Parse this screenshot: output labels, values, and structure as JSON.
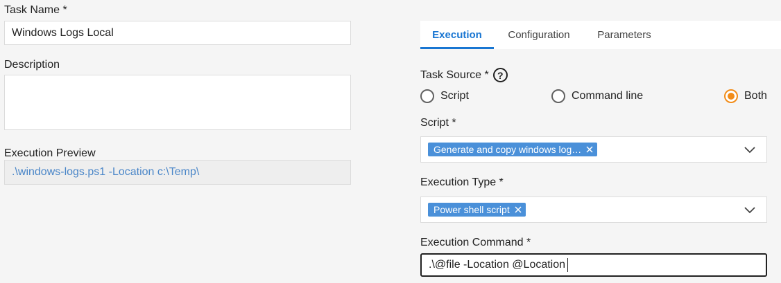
{
  "left": {
    "task_name_label": "Task Name *",
    "task_name_value": "Windows Logs Local",
    "description_label": "Description",
    "description_value": "",
    "preview_label": "Execution Preview",
    "preview_value": ".\\windows-logs.ps1 -Location c:\\Temp\\"
  },
  "tabs": [
    {
      "label": "Execution",
      "active": true
    },
    {
      "label": "Configuration",
      "active": false
    },
    {
      "label": "Parameters",
      "active": false
    }
  ],
  "task_source": {
    "label": "Task Source *",
    "help_icon": "question-circle-icon",
    "options": [
      {
        "label": "Script",
        "checked": false
      },
      {
        "label": "Command line",
        "checked": false
      },
      {
        "label": "Both",
        "checked": true
      }
    ]
  },
  "script": {
    "label": "Script *",
    "chip": "Generate and copy windows log…"
  },
  "execution_type": {
    "label": "Execution Type *",
    "chip": "Power shell script"
  },
  "execution_command": {
    "label": "Execution Command *",
    "value": ".\\@file -Location @Location"
  },
  "colors": {
    "accent": "#1976d2",
    "radio_checked": "#f28c18",
    "chip_bg": "#4a90d9",
    "preview_text": "#4a86c8"
  }
}
